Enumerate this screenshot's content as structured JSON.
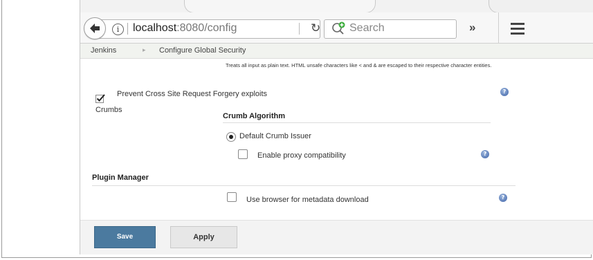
{
  "browser": {
    "url_host": "localhost",
    "url_rest": ":8080/config",
    "search_placeholder": "Search",
    "overflow_label": "»"
  },
  "breadcrumbs": [
    "Jenkins",
    "Configure Global Security"
  ],
  "main": {
    "markup_description": "Treats all input as plain text. HTML unsafe characters like < and & are escaped to their respective character entities.",
    "csrf_label": "Prevent Cross Site Request Forgery exploits",
    "crumbs_label": "Crumbs",
    "crumb_algorithm_title": "Crumb Algorithm",
    "default_issuer_label": "Default Crumb Issuer",
    "proxy_compat_label": "Enable proxy compatibility",
    "plugin_manager_title": "Plugin Manager",
    "browser_metadata_label": "Use browser for metadata download"
  },
  "buttons": {
    "save": "Save",
    "apply": "Apply"
  },
  "icons": {
    "back": "back-arrow-icon",
    "info": "info-icon",
    "reload": "reload-icon",
    "search": "search-engine-icon",
    "menu": "hamburger-menu-icon",
    "help": "help-icon"
  },
  "colors": {
    "save_button": "#4b7a9f",
    "help_icon": "#3d62a8",
    "breadcrumb_bg": "#f1f3ef"
  }
}
